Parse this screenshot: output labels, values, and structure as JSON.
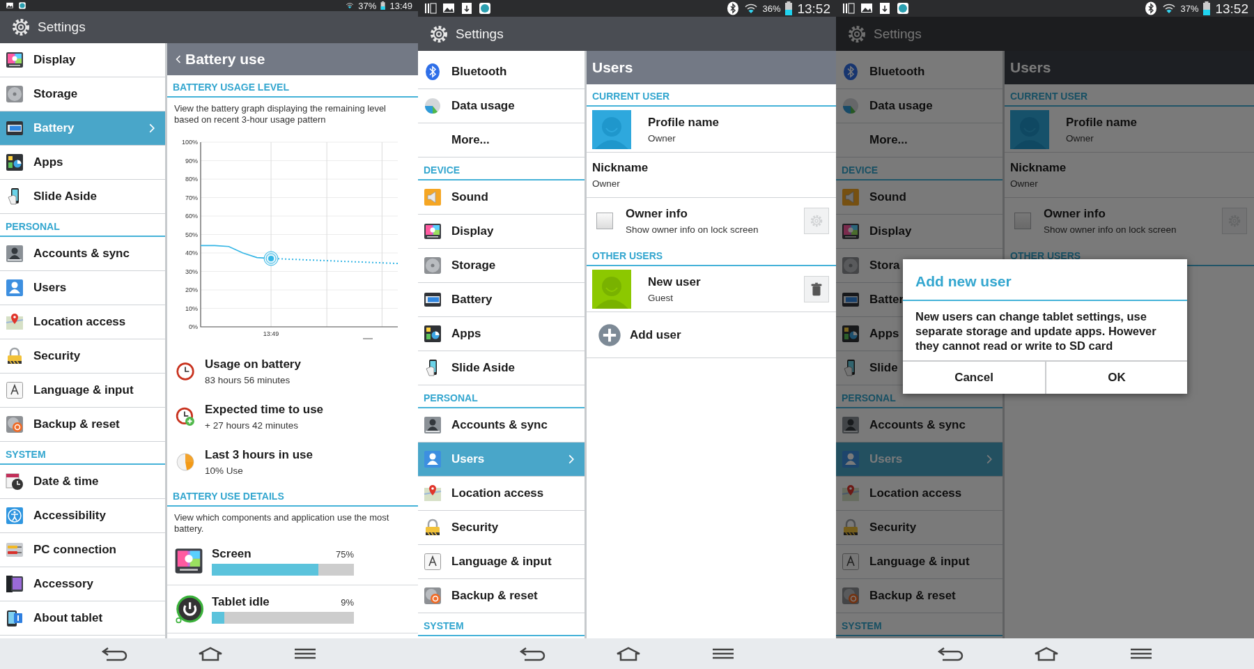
{
  "screens": [
    {
      "status_bar": {
        "battery": "37%",
        "time": "13:49"
      },
      "app_title": "Settings",
      "sidebar": [
        {
          "kind": "item",
          "label": "Display",
          "selected": false
        },
        {
          "kind": "item",
          "label": "Storage",
          "selected": false
        },
        {
          "kind": "item",
          "label": "Battery",
          "selected": true
        },
        {
          "kind": "item",
          "label": "Apps",
          "selected": false
        },
        {
          "kind": "item",
          "label": "Slide Aside",
          "selected": false
        },
        {
          "kind": "header",
          "label": "PERSONAL"
        },
        {
          "kind": "item",
          "label": "Accounts & sync",
          "selected": false
        },
        {
          "kind": "item",
          "label": "Users",
          "selected": false
        },
        {
          "kind": "item",
          "label": "Location access",
          "selected": false
        },
        {
          "kind": "item",
          "label": "Security",
          "selected": false
        },
        {
          "kind": "item",
          "label": "Language & input",
          "selected": false
        },
        {
          "kind": "item",
          "label": "Backup & reset",
          "selected": false
        },
        {
          "kind": "header",
          "label": "SYSTEM"
        },
        {
          "kind": "item",
          "label": "Date & time",
          "selected": false
        },
        {
          "kind": "item",
          "label": "Accessibility",
          "selected": false
        },
        {
          "kind": "item",
          "label": "PC connection",
          "selected": false
        },
        {
          "kind": "item",
          "label": "Accessory",
          "selected": false
        },
        {
          "kind": "item",
          "label": "About tablet",
          "selected": false
        }
      ],
      "detail": {
        "kind": "battery",
        "title": "Battery use",
        "usage_header": "BATTERY USAGE LEVEL",
        "usage_description": "View the battery graph displaying the remaining level based on recent 3-hour usage pattern",
        "chart_data": {
          "type": "line",
          "ylim": [
            0,
            100
          ],
          "grid": true,
          "annotations": [
            "13:49"
          ],
          "yticks": [
            {
              "value": 0,
              "label": "0%"
            },
            {
              "value": 10,
              "label": "10%"
            },
            {
              "value": 20,
              "label": "20%"
            },
            {
              "value": 30,
              "label": "30%"
            },
            {
              "value": 40,
              "label": "40%"
            },
            {
              "value": 50,
              "label": "50%"
            },
            {
              "value": 60,
              "label": "60%"
            },
            {
              "value": 70,
              "label": "70%"
            },
            {
              "value": 80,
              "label": "80%"
            },
            {
              "value": 90,
              "label": "90%"
            },
            {
              "value": 100,
              "label": "100%"
            }
          ],
          "series": [
            {
              "color": "#33b5e5",
              "line_style": "solid",
              "values": [
                44,
                44,
                43.5,
                40,
                37.5,
                37,
                null,
                null,
                null,
                null,
                null,
                null,
                null,
                null,
                null
              ]
            },
            {
              "color": "#33b5e5",
              "line_style": "dotted",
              "values": [
                null,
                null,
                null,
                null,
                null,
                37,
                36.7,
                36.4,
                36.1,
                35.8,
                35.5,
                35.2,
                34.9,
                34.6,
                34.3
              ]
            }
          ]
        },
        "stats": [
          {
            "title": "Usage on battery",
            "value": "83 hours 56 minutes"
          },
          {
            "title": "Expected time to use",
            "value": "+ 27 hours 42 minutes"
          },
          {
            "title": "Last 3 hours in use",
            "value": "10% Use"
          }
        ],
        "details_header": "BATTERY USE DETAILS",
        "details_description": "View which components and application use the most battery.",
        "consumers": [
          {
            "name": "Screen",
            "percent": "75%",
            "level": 0.75
          },
          {
            "name": "Tablet idle",
            "percent": "9%",
            "level": 0.09
          }
        ]
      }
    },
    {
      "status_bar": {
        "battery": "36%",
        "time": "13:52"
      },
      "app_title": "Settings",
      "sidebar": [
        {
          "kind": "item",
          "label": "Bluetooth",
          "selected": false
        },
        {
          "kind": "item",
          "label": "Data usage",
          "selected": false
        },
        {
          "kind": "item",
          "label": "More...",
          "selected": false
        },
        {
          "kind": "header",
          "label": "DEVICE"
        },
        {
          "kind": "item",
          "label": "Sound",
          "selected": false
        },
        {
          "kind": "item",
          "label": "Display",
          "selected": false
        },
        {
          "kind": "item",
          "label": "Storage",
          "selected": false
        },
        {
          "kind": "item",
          "label": "Battery",
          "selected": false
        },
        {
          "kind": "item",
          "label": "Apps",
          "selected": false
        },
        {
          "kind": "item",
          "label": "Slide Aside",
          "selected": false
        },
        {
          "kind": "header",
          "label": "PERSONAL"
        },
        {
          "kind": "item",
          "label": "Accounts & sync",
          "selected": false
        },
        {
          "kind": "item",
          "label": "Users",
          "selected": true
        },
        {
          "kind": "item",
          "label": "Location access",
          "selected": false
        },
        {
          "kind": "item",
          "label": "Security",
          "selected": false
        },
        {
          "kind": "item",
          "label": "Language & input",
          "selected": false
        },
        {
          "kind": "item",
          "label": "Backup & reset",
          "selected": false
        },
        {
          "kind": "header",
          "label": "SYSTEM"
        }
      ],
      "detail": {
        "kind": "users",
        "title": "Users",
        "current_header": "CURRENT USER",
        "profile": {
          "name": "Profile name",
          "role": "Owner"
        },
        "nickname": {
          "label": "Nickname",
          "value": "Owner"
        },
        "owner_info": {
          "title": "Owner info",
          "subtitle": "Show owner info on lock screen",
          "checked": false
        },
        "other_header": "OTHER USERS",
        "other_users": [
          {
            "name": "New user",
            "role": "Guest"
          }
        ],
        "add_user": "Add user"
      }
    },
    {
      "status_bar": {
        "battery": "37%",
        "time": "13:52"
      },
      "app_title": "Settings",
      "sidebar": [
        {
          "kind": "item",
          "label": "Bluetooth",
          "selected": false
        },
        {
          "kind": "item",
          "label": "Data usage",
          "selected": false
        },
        {
          "kind": "item",
          "label": "More...",
          "selected": false
        },
        {
          "kind": "header",
          "label": "DEVICE"
        },
        {
          "kind": "item",
          "label": "Sound",
          "selected": false
        },
        {
          "kind": "item",
          "label": "Display",
          "selected": false
        },
        {
          "kind": "item",
          "label": "Stora",
          "selected": false
        },
        {
          "kind": "item",
          "label": "Batter",
          "selected": false
        },
        {
          "kind": "item",
          "label": "Apps",
          "selected": false
        },
        {
          "kind": "item",
          "label": "Slide",
          "selected": false
        },
        {
          "kind": "header",
          "label": "PERSONAL"
        },
        {
          "kind": "item",
          "label": "Accounts & sync",
          "selected": false
        },
        {
          "kind": "item",
          "label": "Users",
          "selected": true
        },
        {
          "kind": "item",
          "label": "Location access",
          "selected": false
        },
        {
          "kind": "item",
          "label": "Security",
          "selected": false
        },
        {
          "kind": "item",
          "label": "Language & input",
          "selected": false
        },
        {
          "kind": "item",
          "label": "Backup & reset",
          "selected": false
        },
        {
          "kind": "header",
          "label": "SYSTEM"
        }
      ],
      "detail": {
        "kind": "users",
        "title": "Users",
        "current_header": "CURRENT USER",
        "profile": {
          "name": "Profile name",
          "role": "Owner"
        },
        "nickname": {
          "label": "Nickname",
          "value": "Owner"
        },
        "owner_info": {
          "title": "Owner info",
          "subtitle": "Show owner info on lock screen",
          "checked": false
        },
        "other_header": "OTHER USERS"
      },
      "dialog": {
        "title": "Add new user",
        "message": "New users can change tablet settings, use separate storage and update apps. However they cannot read or write to SD card",
        "buttons": [
          "Cancel",
          "OK"
        ]
      }
    }
  ]
}
